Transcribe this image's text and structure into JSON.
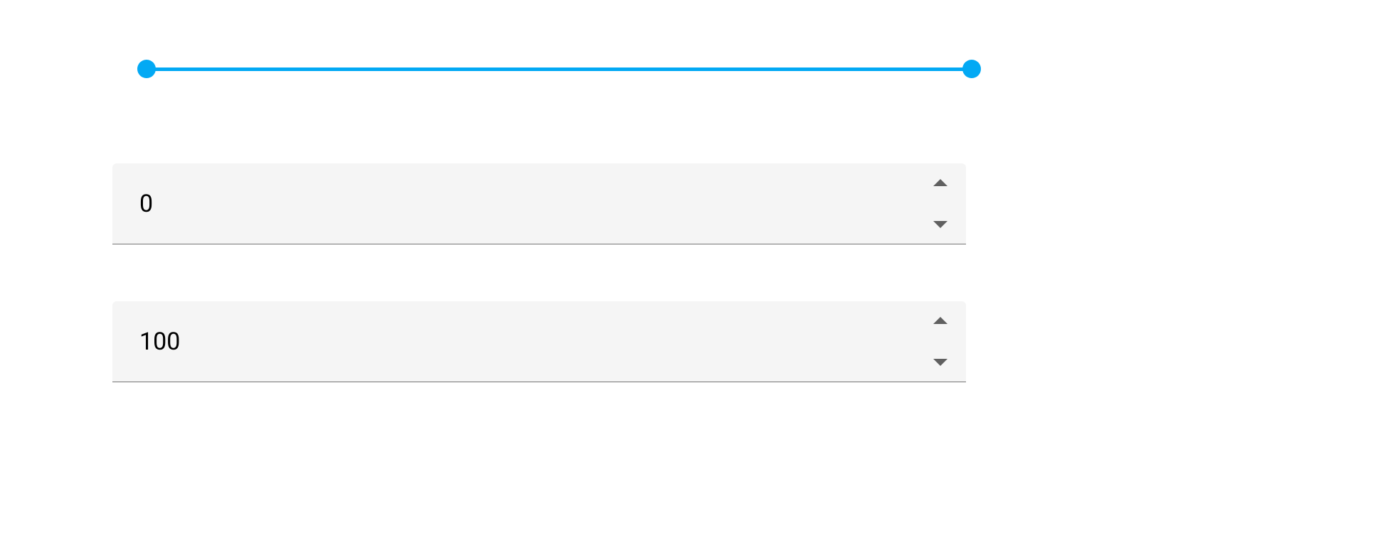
{
  "slider": {
    "min": 0,
    "max": 100,
    "value_min": 0,
    "value_max": 100,
    "track_color": "#03a9f4",
    "thumb_color": "#03a9f4"
  },
  "inputs": {
    "min_value": "0",
    "max_value": "100"
  }
}
